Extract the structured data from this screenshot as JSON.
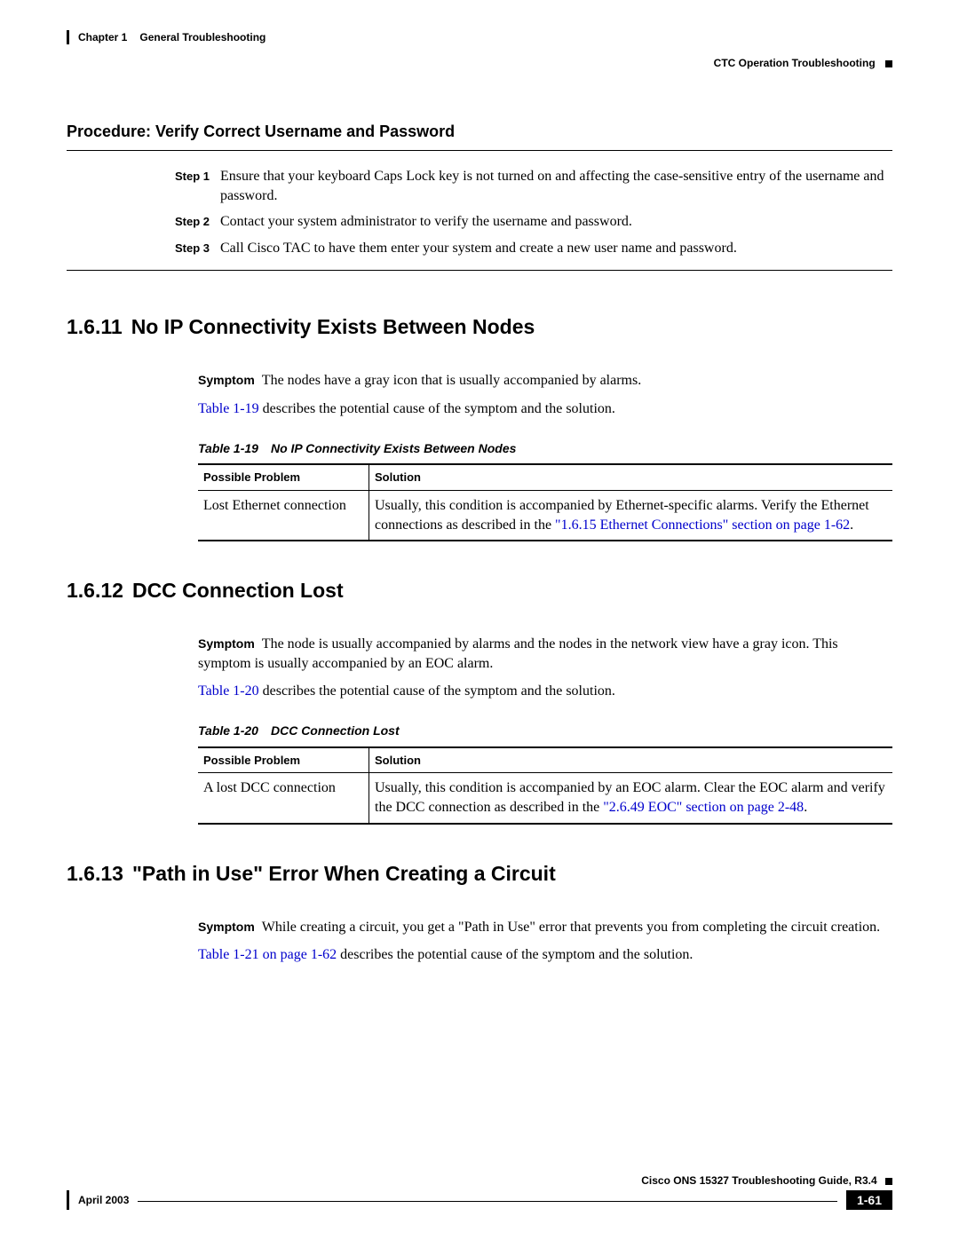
{
  "header": {
    "chapter_label": "Chapter 1",
    "chapter_title": "General Troubleshooting",
    "subheader": "CTC Operation Troubleshooting"
  },
  "procedure": {
    "title": "Procedure: Verify Correct Username and Password",
    "steps": [
      {
        "label": "Step 1",
        "text": "Ensure that your keyboard Caps Lock key is not turned on and affecting the case-sensitive entry of the username and password."
      },
      {
        "label": "Step 2",
        "text": "Contact your system administrator to verify the username and password."
      },
      {
        "label": "Step 3",
        "text": "Call Cisco TAC to have them enter your system and create a new user name and password."
      }
    ]
  },
  "sections": [
    {
      "num": "1.6.11",
      "title": "No IP Connectivity Exists Between Nodes",
      "symptom_label": "Symptom",
      "symptom_text": "The nodes have a gray icon that is usually accompanied by alarms.",
      "desc_link": "Table 1-19",
      "desc_after": " describes the potential cause of the symptom and the solution.",
      "table": {
        "caption_num": "Table 1-19",
        "caption_title": "No IP Connectivity Exists Between Nodes",
        "headers": [
          "Possible Problem",
          "Solution"
        ],
        "row": {
          "problem": "Lost Ethernet connection",
          "solution_before": "Usually, this condition is accompanied by Ethernet-specific alarms. Verify the Ethernet connections as described in the ",
          "solution_link": "\"1.6.15 Ethernet Connections\" section on page 1-62",
          "solution_after": "."
        }
      }
    },
    {
      "num": "1.6.12",
      "title": "DCC Connection Lost",
      "symptom_label": "Symptom",
      "symptom_text": "The node is usually accompanied by alarms and the nodes in the network view have a gray icon. This symptom is usually accompanied by an EOC alarm.",
      "desc_link": "Table 1-20",
      "desc_after": " describes the potential cause of the symptom and the solution.",
      "table": {
        "caption_num": "Table 1-20",
        "caption_title": "DCC Connection Lost",
        "headers": [
          "Possible Problem",
          "Solution"
        ],
        "row": {
          "problem": "A lost DCC connection",
          "solution_before": "Usually, this condition is accompanied by an EOC alarm. Clear the EOC alarm and verify the DCC connection as described in the ",
          "solution_link": "\"2.6.49 EOC\" section on page 2-48",
          "solution_after": "."
        }
      }
    },
    {
      "num": "1.6.13",
      "title": "\"Path in Use\" Error When Creating a Circuit",
      "symptom_label": "Symptom",
      "symptom_text": "While creating a circuit, you get a \"Path in Use\" error that prevents you from completing the circuit creation.",
      "desc_link": "Table 1-21 on page 1-62",
      "desc_after": " describes the potential cause of the symptom and the solution."
    }
  ],
  "footer": {
    "guide": "Cisco ONS 15327 Troubleshooting Guide, R3.4",
    "date": "April 2003",
    "page": "1-61"
  }
}
